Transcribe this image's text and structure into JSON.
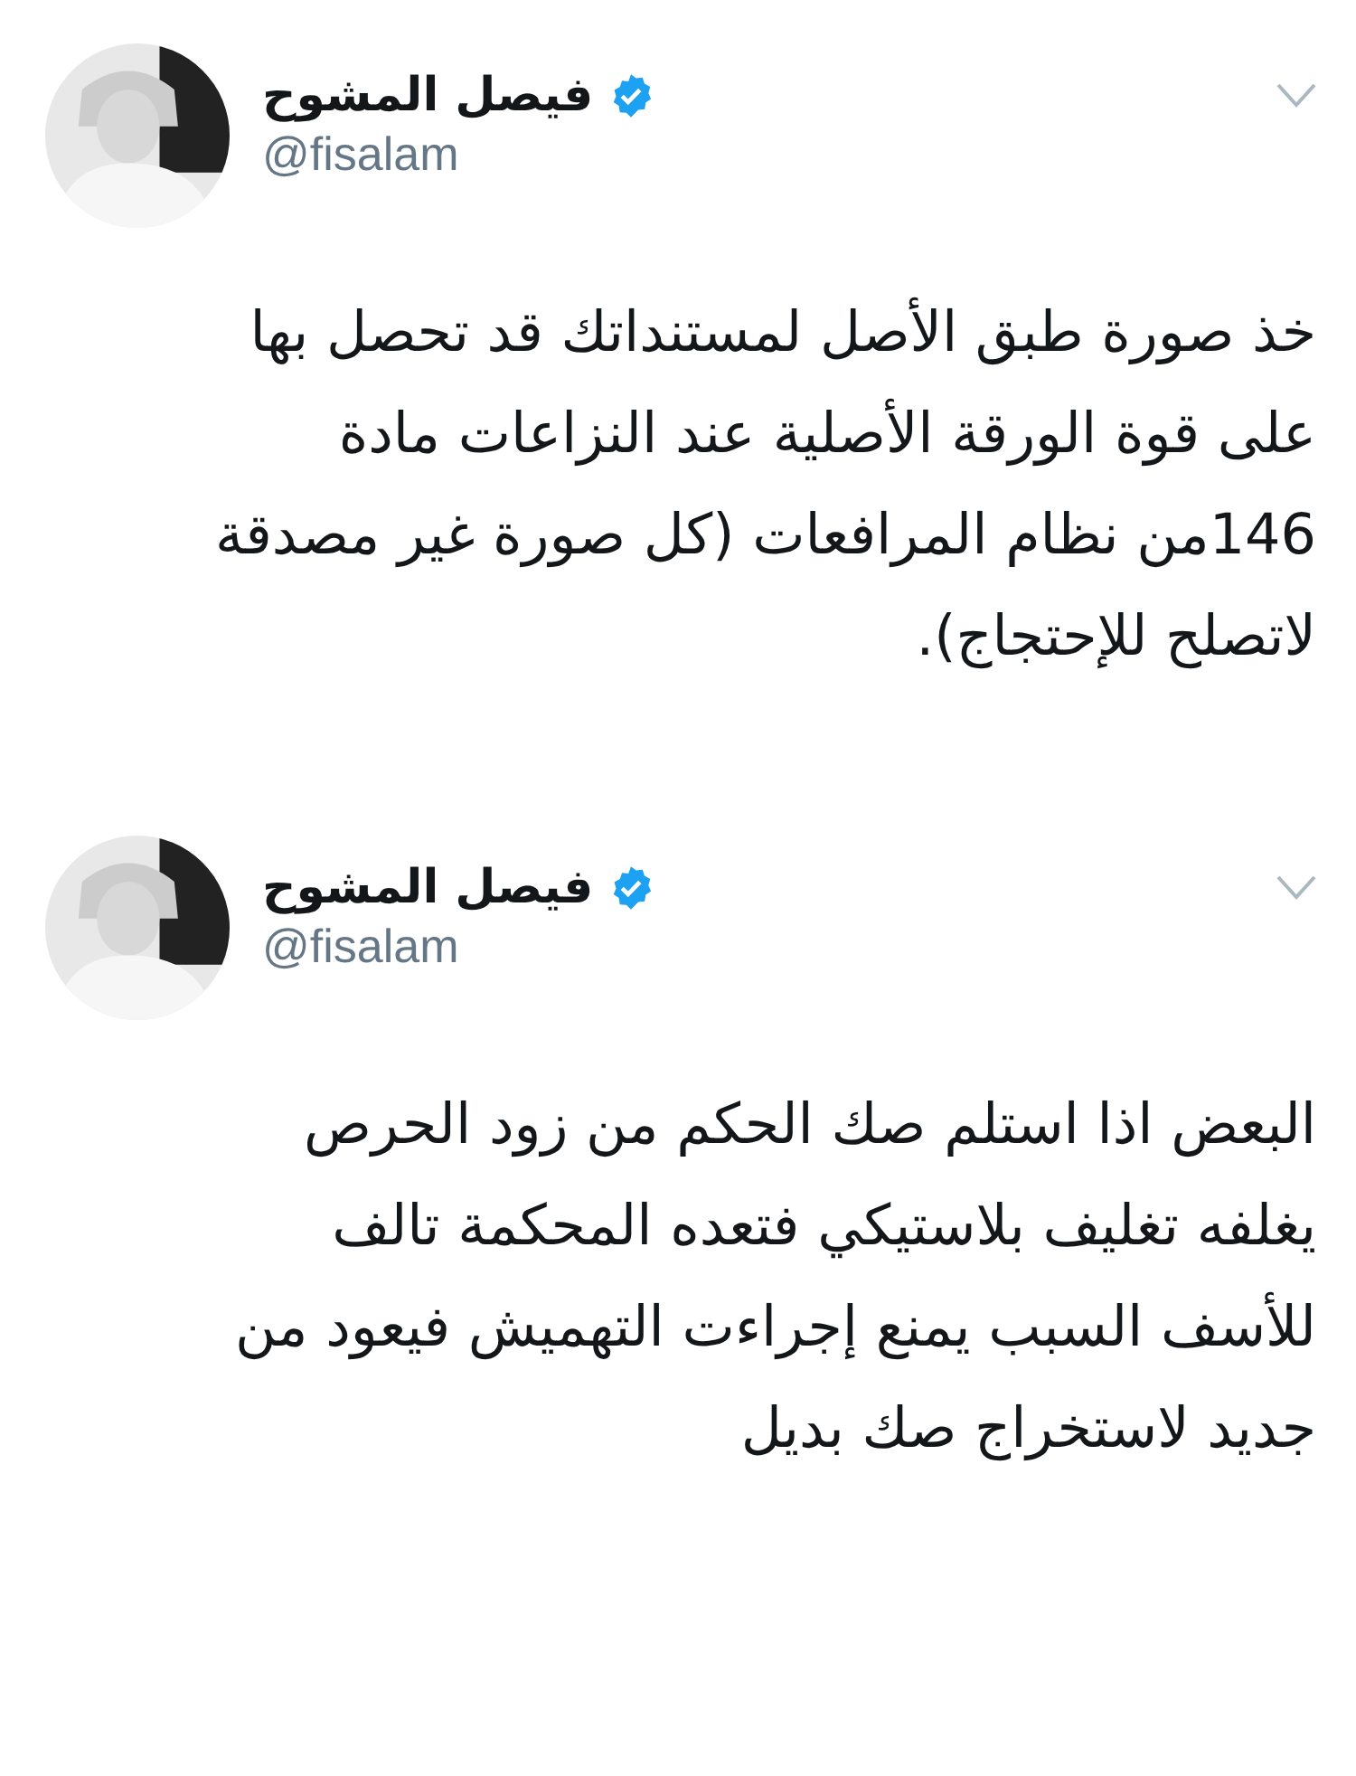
{
  "tweets": [
    {
      "name": "فيصل المشوح",
      "verified": true,
      "handle": "@fisalam",
      "text": "خذ صورة طبق الأصل لمستنداتك قد تحصل بها\nعلى قوة الورقة الأصلية عند النزاعات مادة\n146من نظام المرافعات (كل صورة غير مصدقة\nلاتصلح للإحتجاج)."
    },
    {
      "name": "فيصل المشوح",
      "verified": true,
      "handle": "@fisalam",
      "text": "البعض اذا استلم صك الحكم من زود الحرص\nيغلفه تغليف بلاستيكي فتعده المحكمة تالف\nللأسف السبب يمنع إجراءت التهميش فيعود من\nجديد لاستخراج صك بديل"
    }
  ]
}
